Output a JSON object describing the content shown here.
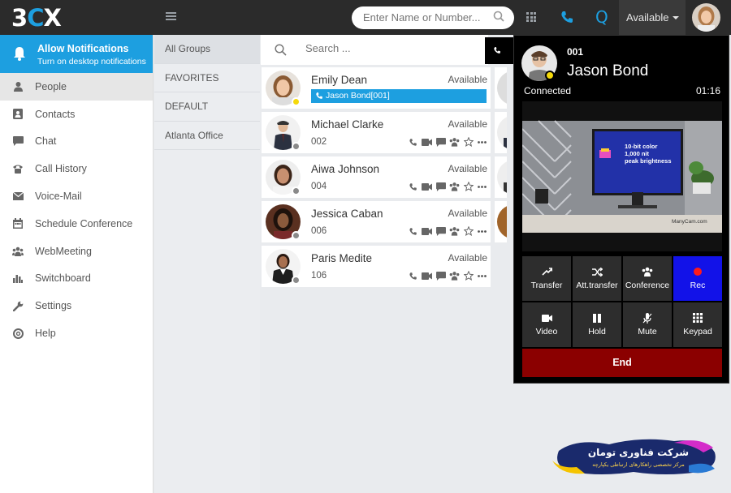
{
  "app": {
    "logo_left": "3",
    "logo_mid": "C",
    "logo_right": "X"
  },
  "topbar": {
    "search_placeholder": "Enter Name or Number...",
    "status": "Available",
    "quick_label": "Q"
  },
  "notification": {
    "title": "Allow Notifications",
    "subtitle": "Turn on desktop notifications"
  },
  "sidebar": {
    "items": [
      {
        "label": "People",
        "icon": "person-icon"
      },
      {
        "label": "Contacts",
        "icon": "contacts-icon"
      },
      {
        "label": "Chat",
        "icon": "chat-icon"
      },
      {
        "label": "Call History",
        "icon": "call-history-icon"
      },
      {
        "label": "Voice-Mail",
        "icon": "voicemail-icon"
      },
      {
        "label": "Schedule Conference",
        "icon": "calendar-icon"
      },
      {
        "label": "WebMeeting",
        "icon": "webmeeting-icon"
      },
      {
        "label": "Switchboard",
        "icon": "switchboard-icon"
      },
      {
        "label": "Settings",
        "icon": "wrench-icon"
      },
      {
        "label": "Help",
        "icon": "help-icon"
      }
    ]
  },
  "groups": [
    "All Groups",
    "FAVORITES",
    "DEFAULT",
    "Atlanta Office"
  ],
  "people_search_placeholder": "Search ...",
  "people": [
    {
      "name": "Emily Dean",
      "status": "Available",
      "ext": "",
      "call": "Jason Bond[001]",
      "presence": "yellow"
    },
    {
      "name": "Michael Clarke",
      "status": "Available",
      "ext": "002",
      "call": "",
      "presence": "grey"
    },
    {
      "name": "Aiwa Johnson",
      "status": "Available",
      "ext": "004",
      "call": "",
      "presence": "grey"
    },
    {
      "name": "Jessica Caban",
      "status": "Available",
      "ext": "006",
      "call": "",
      "presence": "grey"
    },
    {
      "name": "Paris Medite",
      "status": "Available",
      "ext": "106",
      "call": "",
      "presence": "grey"
    }
  ],
  "call": {
    "ext": "001",
    "name": "Jason Bond",
    "status": "Connected",
    "timer": "01:16",
    "video_text": {
      "line1": "10-bit color",
      "line2": "1,000 nit",
      "line3": "peak brightness",
      "watermark": "ManyCam.com"
    },
    "buttons": [
      {
        "label": "Transfer",
        "icon": "transfer-icon"
      },
      {
        "label": "Att.transfer",
        "icon": "shuffle-icon"
      },
      {
        "label": "Conference",
        "icon": "conference-icon"
      },
      {
        "label": "Rec",
        "icon": "record-icon"
      },
      {
        "label": "Video",
        "icon": "video-icon"
      },
      {
        "label": "Hold",
        "icon": "pause-icon"
      },
      {
        "label": "Mute",
        "icon": "mute-icon"
      },
      {
        "label": "Keypad",
        "icon": "keypad-icon"
      }
    ],
    "end_label": "End"
  },
  "brand": {
    "line1": "شرکت فناوری تومان",
    "line2": "مرکز تخصصی راهکارهای ارتباطی یکپارچه"
  },
  "colors": {
    "accent": "#1d9fe0",
    "topbar": "#2b2b2b",
    "rec": "#1212e8",
    "end": "#8b0000",
    "presence_yellow": "#f5d90a"
  }
}
